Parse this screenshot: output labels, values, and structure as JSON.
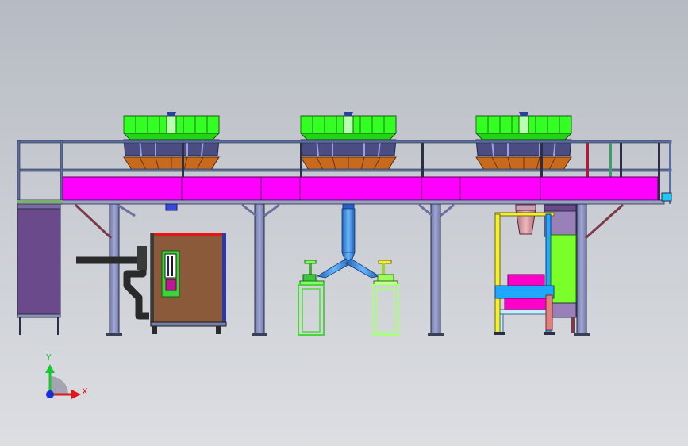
{
  "viewport": {
    "background": "gradient-gray",
    "colors": {
      "frame_outline": "#2a2f45",
      "structure": "#8a90b8",
      "platform_band": "#ff00ff",
      "weigher_top": "#33ff22",
      "weigher_mid": "#4a4c82",
      "weigher_bottom": "#c86a1e",
      "duct": "#3a8ee0",
      "cabinet": "#8a5a3a",
      "panel_left": "#6a4a8a",
      "stand": "#7dff6b",
      "bagger_blue": "#1ea8ff",
      "bagger_green": "#7aff2a",
      "bagger_yellow": "#f6ef2a"
    }
  },
  "assembly": {
    "weighers": [
      {
        "id": "weigher-1"
      },
      {
        "id": "weigher-2"
      },
      {
        "id": "weigher-3"
      }
    ],
    "components": [
      "platform-frame",
      "support-legs",
      "control-cabinet",
      "y-discharge-chute",
      "work-stands",
      "packaging-machine",
      "left-panel"
    ]
  },
  "triad": {
    "x_label": "X",
    "y_label": "Y",
    "x_color": "#e01818",
    "y_color": "#18c830",
    "z_color": "#1a2ed8"
  }
}
